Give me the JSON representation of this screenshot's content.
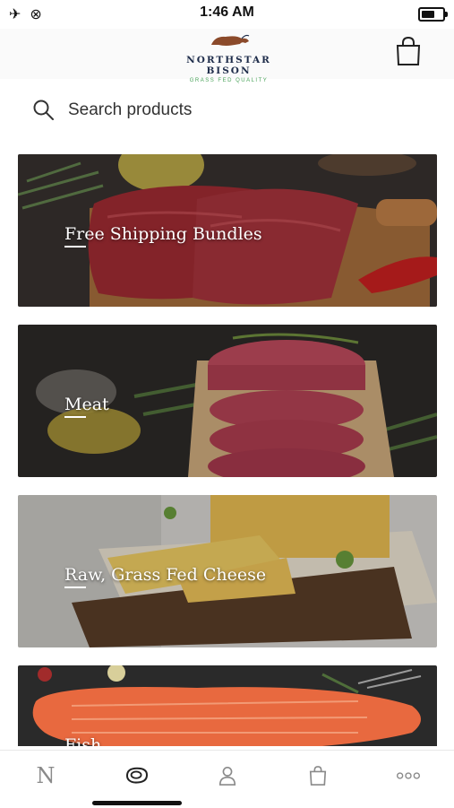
{
  "status_bar": {
    "time": "1:46 AM",
    "airplane_icon": "airplane-icon",
    "link_icon": "link-icon",
    "battery_icon": "battery-icon"
  },
  "header": {
    "brand_name": "NORTHSTAR BISON",
    "brand_tagline": "GRASS FED QUALITY",
    "cart_icon": "shopping-bag-icon"
  },
  "search": {
    "placeholder": "Search products",
    "value": ""
  },
  "categories": [
    {
      "label": "Free Shipping Bundles"
    },
    {
      "label": "Meat"
    },
    {
      "label": "Raw, Grass Fed Cheese"
    },
    {
      "label": "Fish"
    }
  ],
  "tabbar": {
    "items": [
      {
        "name": "home",
        "label": "N",
        "icon": "northstar-n-icon"
      },
      {
        "name": "shop",
        "icon": "steak-icon",
        "active": true
      },
      {
        "name": "account",
        "icon": "person-icon"
      },
      {
        "name": "cart",
        "icon": "shopping-bag-icon"
      },
      {
        "name": "more",
        "icon": "more-dots-icon"
      }
    ]
  },
  "colors": {
    "brand_navy": "#1e2c4a",
    "brand_green": "#4aa35a",
    "tab_inactive": "#8a8a8a"
  }
}
